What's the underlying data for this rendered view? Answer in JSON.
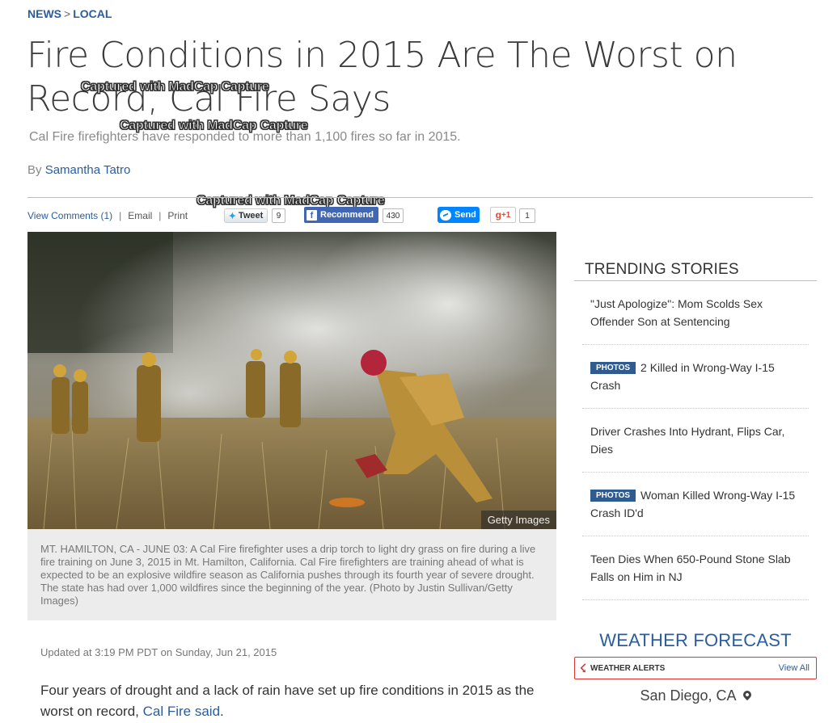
{
  "breadcrumb": {
    "news": "NEWS",
    "separator": ">",
    "local": "LOCAL"
  },
  "article": {
    "headline": "Fire Conditions in 2015 Are The Worst on Record, Cal Fire Says",
    "subhead": "Cal Fire firefighters have responded to more than 1,100 fires so far in 2015.",
    "byline_prefix": "By",
    "author": "Samantha Tatro",
    "photo_credit": "Getty Images",
    "caption": "MT. HAMILTON, CA - JUNE 03: A Cal Fire firefighter uses a drip torch to light dry grass on fire during a live fire training on June 3, 2015 in Mt. Hamilton, California. Cal Fire firefighters are training ahead of what is expected to be an explosive wildfire season as California pushes through its fourth year of severe drought. The state has had over 1,000 wildfires since the beginning of the year. (Photo by Justin Sullivan/Getty Images)",
    "updated": "Updated at 3:19 PM PDT on Sunday, Jun 21, 2015",
    "body_text": "Four years of drought and a lack of rain have set up fire conditions in 2015 as the worst on record,",
    "body_link": "Cal Fire said",
    "body_end": "."
  },
  "share": {
    "view_comments": "View Comments (1)",
    "email": "Email",
    "print": "Print",
    "pipe": "|",
    "tweet_label": "Tweet",
    "tweet_count": "9",
    "fb_label": "Recommend",
    "fb_count": "430",
    "messenger_label": "Send",
    "gplus_label": "+1",
    "gplus_count": "1"
  },
  "watermarks": [
    "Captured with MadCap Capture",
    "Captured with MadCap Capture",
    "Captured with MadCap Capture"
  ],
  "trending": {
    "title": "TRENDING STORIES",
    "items": [
      {
        "badge": "",
        "text": "\"Just Apologize\": Mom Scolds Sex Offender Son at Sentencing"
      },
      {
        "badge": "PHOTOS",
        "text": "2 Killed in Wrong-Way I-15 Crash"
      },
      {
        "badge": "",
        "text": "Driver Crashes Into Hydrant, Flips Car, Dies"
      },
      {
        "badge": "PHOTOS",
        "text": "Woman Killed Wrong-Way I-15 Crash ID'd"
      },
      {
        "badge": "",
        "text": "Teen Dies When 650-Pound Stone Slab Falls on Him in NJ"
      }
    ]
  },
  "weather": {
    "title": "WEATHER FORECAST",
    "alerts_label": "WEATHER ALERTS",
    "view_all": "View All",
    "location": "San Diego, CA"
  },
  "colors": {
    "link": "#2a5d9e",
    "badge": "#2f5b91",
    "alert": "#dd3333",
    "facebook": "#4267b2",
    "messenger": "#0084ff"
  }
}
